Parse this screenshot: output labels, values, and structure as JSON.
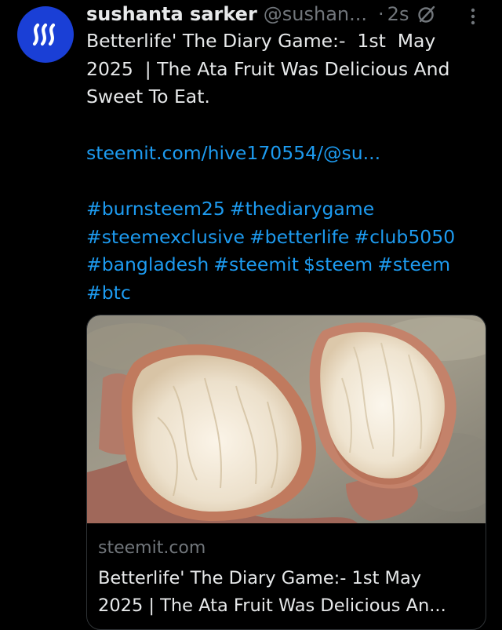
{
  "tweet": {
    "author": {
      "name": "sushanta sarker",
      "handle": "@sushan...",
      "avatar_icon": "steem-logo-icon",
      "avatar_color": "#1a3fd6"
    },
    "separator": "·",
    "time": "2s",
    "text_lines": [
      "Betterlife' The Diary Game:-  1st  May",
      "2025  | The Ata Fruit Was Delicious And",
      "Sweet To Eat."
    ],
    "link": "steemit.com/hive170554/@su...",
    "hashtag_lines": [
      [
        "#burnsteem25",
        "#thediarygame"
      ],
      [
        "#steemexclusive",
        "#betterlife",
        "#club5050"
      ],
      [
        "#bangladesh",
        "#steemit",
        "$steem",
        "#steem"
      ],
      [
        "#btc"
      ]
    ]
  },
  "card": {
    "domain": "steemit.com",
    "title_lines": [
      "Betterlife' The Diary Game:- 1st May",
      "2025 | The Ata Fruit Was Delicious An..."
    ],
    "image_icon": "ata-fruit-photo"
  },
  "colors": {
    "background": "#000000",
    "text": "#e7e9ea",
    "muted": "#71767b",
    "link": "#1d9bf0",
    "border": "#2f3336"
  }
}
